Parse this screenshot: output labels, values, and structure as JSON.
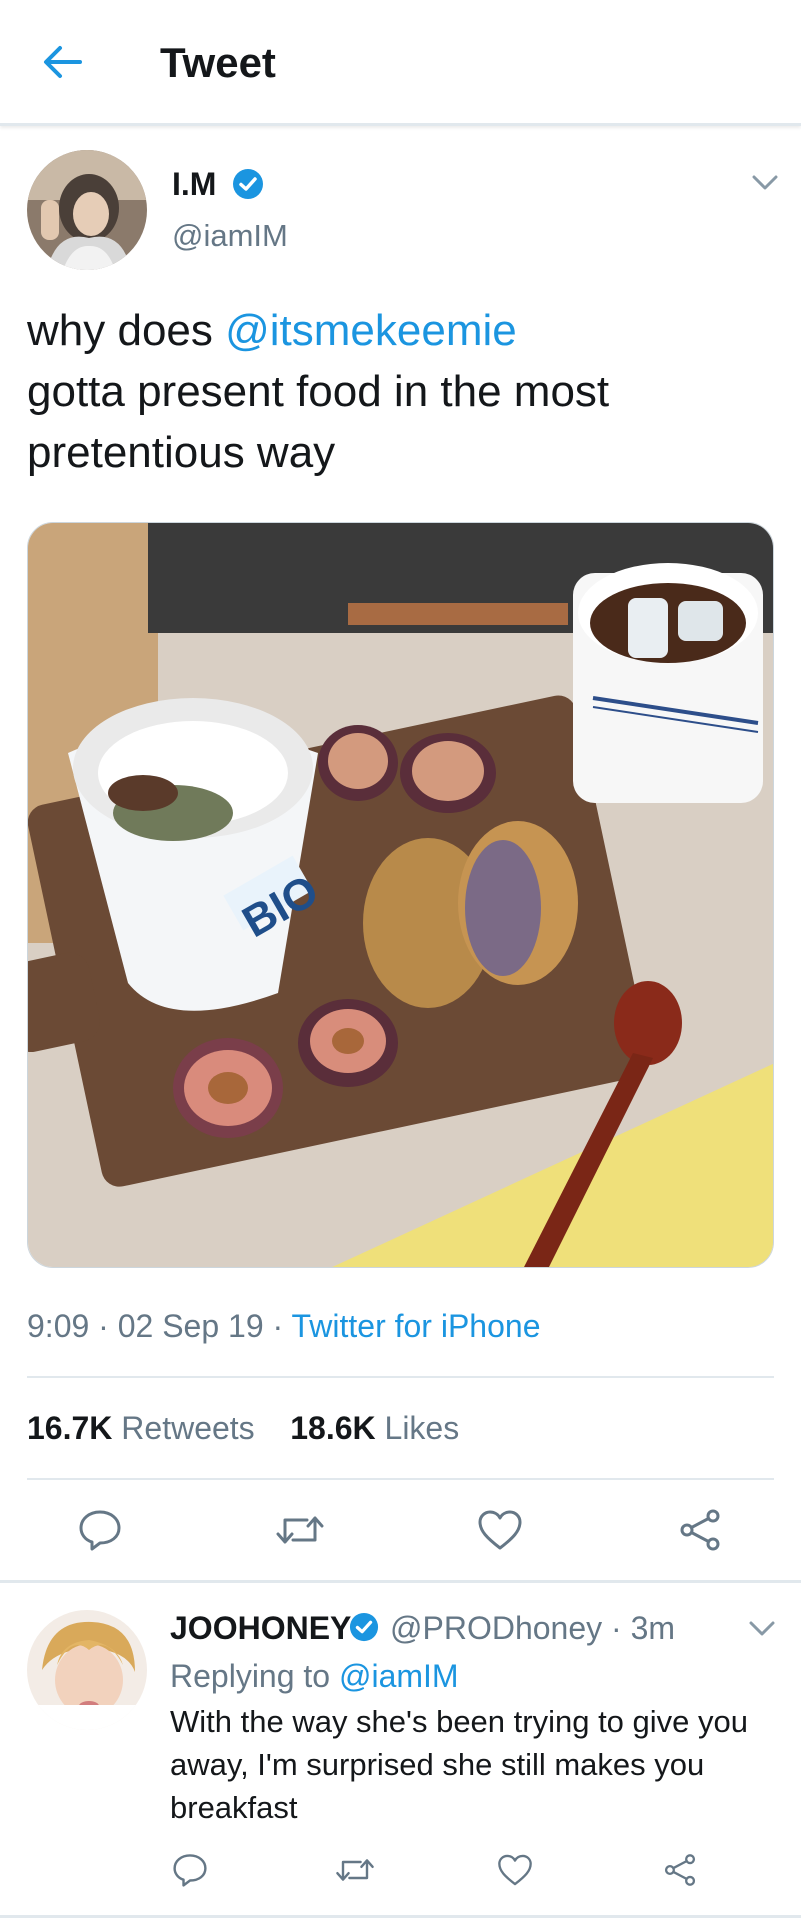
{
  "header": {
    "title": "Tweet",
    "back_icon": "arrow-left-icon"
  },
  "tweet": {
    "author_name": "I.M",
    "verified": true,
    "author_handle": "@iamIM",
    "text_before": "why does ",
    "mention": "@itsmekeemie",
    "text_after": " gotta present food in the most pretentious way",
    "time": "9:09",
    "date": "02 Sep 19",
    "source": "Twitter for iPhone",
    "retweets_count": "16.7K",
    "retweets_label": "Retweets",
    "likes_count": "18.6K",
    "likes_label": "Likes",
    "media_label": "BIO"
  },
  "actions": [
    {
      "name": "reply",
      "icon": "reply-icon"
    },
    {
      "name": "retweet",
      "icon": "retweet-icon"
    },
    {
      "name": "like",
      "icon": "heart-icon"
    },
    {
      "name": "share",
      "icon": "share-icon"
    }
  ],
  "reply": {
    "author_name": "JOOHONEY",
    "verified": true,
    "author_handle": "@PRODhoney",
    "separator": "·",
    "time_ago": "3m",
    "replying_to_label": "Replying to",
    "replying_to_handle": "@iamIM",
    "text": "With the way she's been trying to give you away, I'm surprised she still makes you breakfast"
  },
  "colors": {
    "accent": "#1b95e0",
    "secondary_text": "#657786",
    "primary_text": "#14171a",
    "divider": "#e1e8ed"
  }
}
